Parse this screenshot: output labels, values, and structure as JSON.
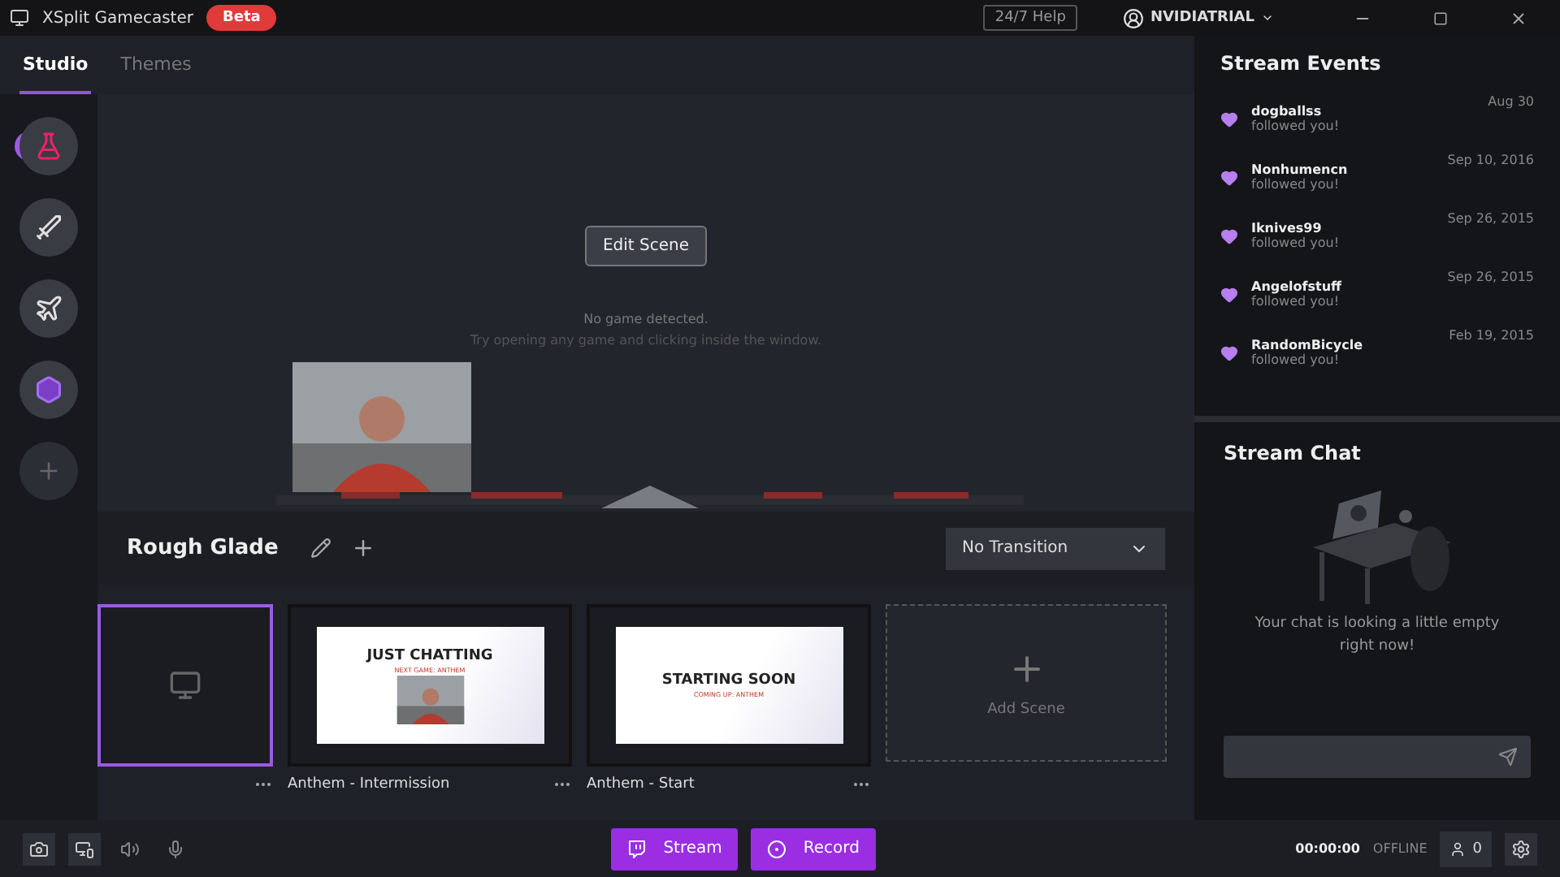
{
  "app": {
    "title": "XSplit Gamecaster",
    "badge": "Beta"
  },
  "header": {
    "help": "24/7 Help",
    "user": "NVIDIATRIAL"
  },
  "tabs": [
    {
      "label": "Studio",
      "selected": true
    },
    {
      "label": "Themes",
      "selected": false
    }
  ],
  "rail": [
    {
      "kind": "potion",
      "selected": true
    },
    {
      "kind": "sword",
      "selected": false
    },
    {
      "kind": "plane",
      "selected": false
    },
    {
      "kind": "emblem",
      "selected": false
    }
  ],
  "preview": {
    "edit_button": "Edit Scene",
    "message": "No game detected.",
    "hint": "Try opening any game and clicking inside the window."
  },
  "scene_bar": {
    "name": "Rough Glade",
    "transition": "No Transition"
  },
  "scenes": [
    {
      "kind": "empty",
      "selected": true
    },
    {
      "kind": "slide",
      "selected": false,
      "name": "Anthem - Intermission",
      "title": "JUST CHATTING",
      "subtitle": "NEXT GAME: ANTHEM",
      "webcam": true
    },
    {
      "kind": "slide",
      "selected": false,
      "name": "Anthem - Start",
      "title": "STARTING SOON",
      "subtitle": "COMING UP: ANTHEM",
      "webcam": false
    }
  ],
  "add_scene": "Add Scene",
  "events": {
    "title": "Stream Events",
    "items": [
      {
        "name": "dogballss",
        "action": "followed you!",
        "date": "Aug 30"
      },
      {
        "name": "Nonhumencn",
        "action": "followed you!",
        "date": "Sep 10, 2016"
      },
      {
        "name": "Iknives99",
        "action": "followed you!",
        "date": "Sep 26, 2015"
      },
      {
        "name": "Angelofstuff",
        "action": "followed you!",
        "date": "Sep 26, 2015"
      },
      {
        "name": "RandomBicycle",
        "action": "followed you!",
        "date": "Feb 19, 2015"
      }
    ]
  },
  "chat": {
    "title": "Stream Chat",
    "empty": "Your chat is looking a little empty right now!"
  },
  "footer": {
    "stream": "Stream",
    "record": "Record",
    "timer": "00:00:00",
    "status": "OFFLINE",
    "viewers": "0"
  }
}
